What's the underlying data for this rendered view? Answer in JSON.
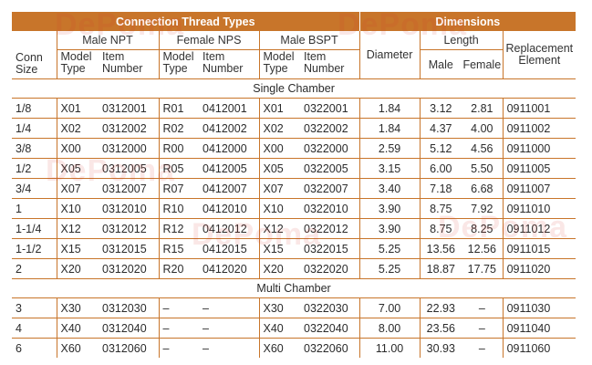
{
  "header": {
    "connection_thread_types": "Connection Thread Types",
    "dimensions": "Dimensions"
  },
  "columns": {
    "conn_size": [
      "Conn",
      "Size"
    ],
    "male_npt": "Male NPT",
    "female_nps": "Female NPS",
    "male_bspt": "Male BSPT",
    "model_type": [
      "Model",
      "Type"
    ],
    "item_number": [
      "Item",
      "Number"
    ],
    "diameter": "Diameter",
    "length": "Length",
    "male": "Male",
    "female": "Female",
    "replacement_element": [
      "Replacement",
      "Element"
    ]
  },
  "sections": [
    {
      "title": "Single Chamber",
      "rows": [
        [
          "1/8",
          "X01",
          "0312001",
          "R01",
          "0412001",
          "X01",
          "0322001",
          "1.84",
          "3.12",
          "2.81",
          "0911001"
        ],
        [
          "1/4",
          "X02",
          "0312002",
          "R02",
          "0412002",
          "X02",
          "0322002",
          "1.84",
          "4.37",
          "4.00",
          "0911002"
        ],
        [
          "3/8",
          "X00",
          "0312000",
          "R00",
          "0412000",
          "X00",
          "0322000",
          "2.59",
          "5.12",
          "4.56",
          "0911000"
        ],
        [
          "1/2",
          "X05",
          "0312005",
          "R05",
          "0412005",
          "X05",
          "0322005",
          "3.15",
          "6.00",
          "5.50",
          "0911005"
        ],
        [
          "3/4",
          "X07",
          "0312007",
          "R07",
          "0412007",
          "X07",
          "0322007",
          "3.40",
          "7.18",
          "6.68",
          "0911007"
        ],
        [
          "1",
          "X10",
          "0312010",
          "R10",
          "0412010",
          "X10",
          "0322010",
          "3.90",
          "8.75",
          "7.92",
          "0911010"
        ],
        [
          "1-1/4",
          "X12",
          "0312012",
          "R12",
          "0412012",
          "X12",
          "0322012",
          "3.90",
          "8.75",
          "8.25",
          "0911012"
        ],
        [
          "1-1/2",
          "X15",
          "0312015",
          "R15",
          "0412015",
          "X15",
          "0322015",
          "5.25",
          "13.56",
          "12.56",
          "0911015"
        ],
        [
          "2",
          "X20",
          "0312020",
          "R20",
          "0412020",
          "X20",
          "0322020",
          "5.25",
          "18.87",
          "17.75",
          "0911020"
        ]
      ]
    },
    {
      "title": "Multi Chamber",
      "rows": [
        [
          "3",
          "X30",
          "0312030",
          "–",
          "–",
          "X30",
          "0322030",
          "7.00",
          "22.93",
          "–",
          "0911030"
        ],
        [
          "4",
          "X40",
          "0312040",
          "–",
          "–",
          "X40",
          "0322040",
          "8.00",
          "23.56",
          "–",
          "0911040"
        ],
        [
          "6",
          "X60",
          "0312060",
          "–",
          "–",
          "X60",
          "0322060",
          "11.00",
          "30.93",
          "–",
          "0911060"
        ]
      ]
    }
  ],
  "watermark": "DePoma",
  "colors": {
    "accent": "#c8752a",
    "text": "#2b2b2b",
    "watermark": "#d23c32"
  }
}
